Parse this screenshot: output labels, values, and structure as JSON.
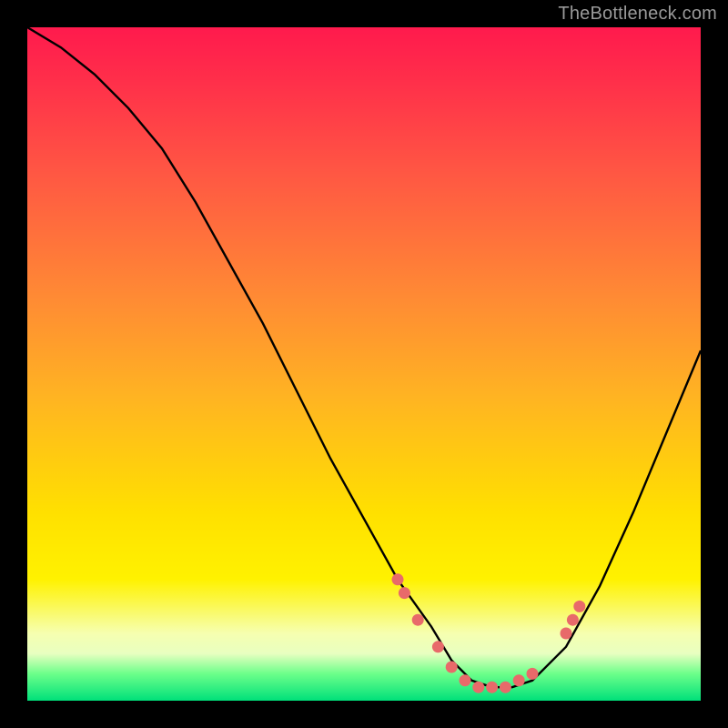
{
  "watermark": "TheBottleneck.com",
  "chart_data": {
    "type": "line",
    "title": "",
    "xlabel": "",
    "ylabel": "",
    "xlim": [
      0,
      100
    ],
    "ylim": [
      0,
      100
    ],
    "series": [
      {
        "name": "bottleneck-curve",
        "x": [
          0,
          5,
          10,
          15,
          20,
          25,
          30,
          35,
          40,
          45,
          50,
          55,
          60,
          63,
          66,
          69,
          72,
          75,
          80,
          85,
          90,
          95,
          100
        ],
        "y": [
          100,
          97,
          93,
          88,
          82,
          74,
          65,
          56,
          46,
          36,
          27,
          18,
          11,
          6,
          3,
          2,
          2,
          3,
          8,
          17,
          28,
          40,
          52
        ]
      }
    ],
    "markers": {
      "name": "highlight-points",
      "color": "#e86a6a",
      "x": [
        55,
        56,
        58,
        61,
        63,
        65,
        67,
        69,
        71,
        73,
        75,
        80,
        81,
        82
      ],
      "y": [
        18,
        16,
        12,
        8,
        5,
        3,
        2,
        2,
        2,
        3,
        4,
        10,
        12,
        14
      ]
    },
    "gradient_stops": [
      {
        "pos": 0.0,
        "color": "#ff1a4d"
      },
      {
        "pos": 0.4,
        "color": "#ff8a34"
      },
      {
        "pos": 0.72,
        "color": "#ffe000"
      },
      {
        "pos": 0.93,
        "color": "#e8ffc0"
      },
      {
        "pos": 1.0,
        "color": "#00e07a"
      }
    ]
  }
}
